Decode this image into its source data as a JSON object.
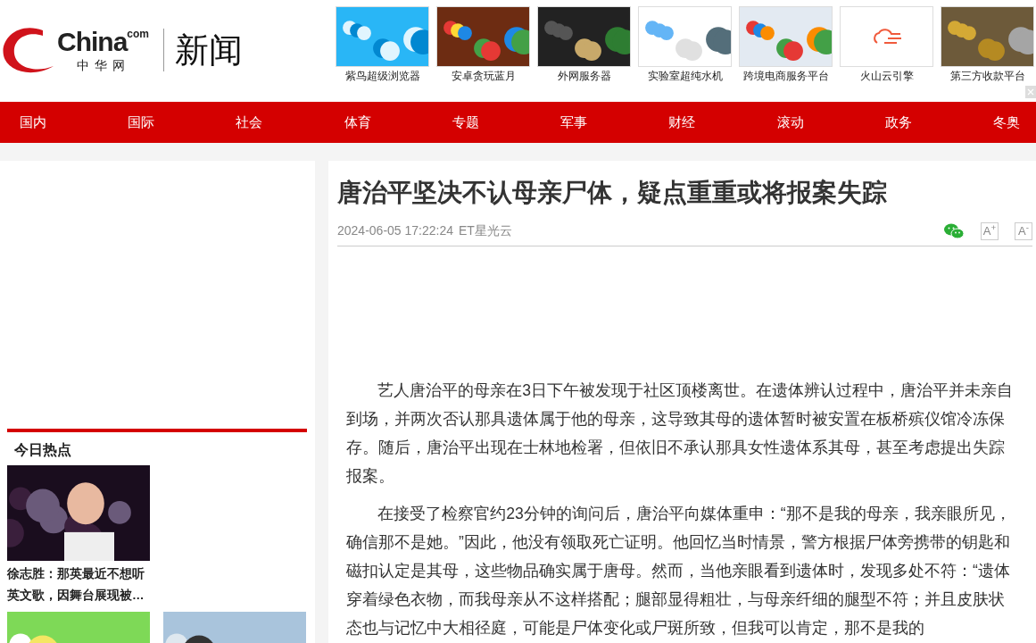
{
  "header": {
    "logo": {
      "latin": "China",
      "superscript": "com",
      "chinese": "中华网"
    },
    "section": "新闻",
    "ads": [
      {
        "caption": "紫鸟超级浏览器",
        "kind": "picture"
      },
      {
        "caption": "安卓贪玩蓝月",
        "kind": "picture"
      },
      {
        "caption": "外网服务器",
        "kind": "picture"
      },
      {
        "caption": "实验室超纯水机",
        "kind": "picture"
      },
      {
        "caption": "跨境电商服务平台",
        "kind": "picture"
      },
      {
        "caption": "火山云引擎",
        "kind": "logo"
      },
      {
        "caption": "第三方收款平台",
        "kind": "picture"
      }
    ]
  },
  "nav": [
    {
      "label": "国内"
    },
    {
      "label": "国际"
    },
    {
      "label": "社会"
    },
    {
      "label": "体育"
    },
    {
      "label": "专题"
    },
    {
      "label": "军事"
    },
    {
      "label": "财经"
    },
    {
      "label": "滚动"
    },
    {
      "label": "政务"
    },
    {
      "label": "冬奥"
    }
  ],
  "sidebar": {
    "heading": "今日热点",
    "stories": [
      {
        "kind": "picture",
        "caption": "徐志胜：那英最近不想听英文歌，因舞台展现被…"
      },
      {
        "kind": "picture"
      },
      {
        "kind": "picture"
      }
    ]
  },
  "article": {
    "title": "唐治平坚决不认母亲尸体，疑点重重或将报案失踪",
    "date": "2024-06-05 17:22:24",
    "source": "ET星光云",
    "font_buttons": [
      "A$^{+}$",
      "A$^{-}$"
    ],
    "paragraphs": [
      "艺人唐治平的母亲在3日下午被发现于社区顶楼离世。在遗体辨认过程中，唐治平并未亲自到场，并两次否认那具遗体属于他的母亲，这导致其母的遗体暂时被安置在板桥殡仪馆冷冻保存。随后，唐治平出现在士林地检署，但依旧不承认那具女性遗体系其母，甚至考虑提出失踪报案。",
      "在接受了检察官约23分钟的询问后，唐治平向媒体重申：“那不是我的母亲，我亲眼所见，确信那不是她。”因此，他没有领取死亡证明。他回忆当时情景，警方根据尸体旁携带的钥匙和磁扣认定是其母，这些物品确实属于唐母。然而，当他亲眼看到遗体时，发现多处不符：“遗体穿着绿色衣物，而我母亲从不这样搭配；腿部显得粗壮，与母亲纤细的腿型不符；并且皮肤状态也与记忆中大相径庭，可能是尸体变化或尸斑所致，但我可以肯定，那不是我的"
    ]
  }
}
